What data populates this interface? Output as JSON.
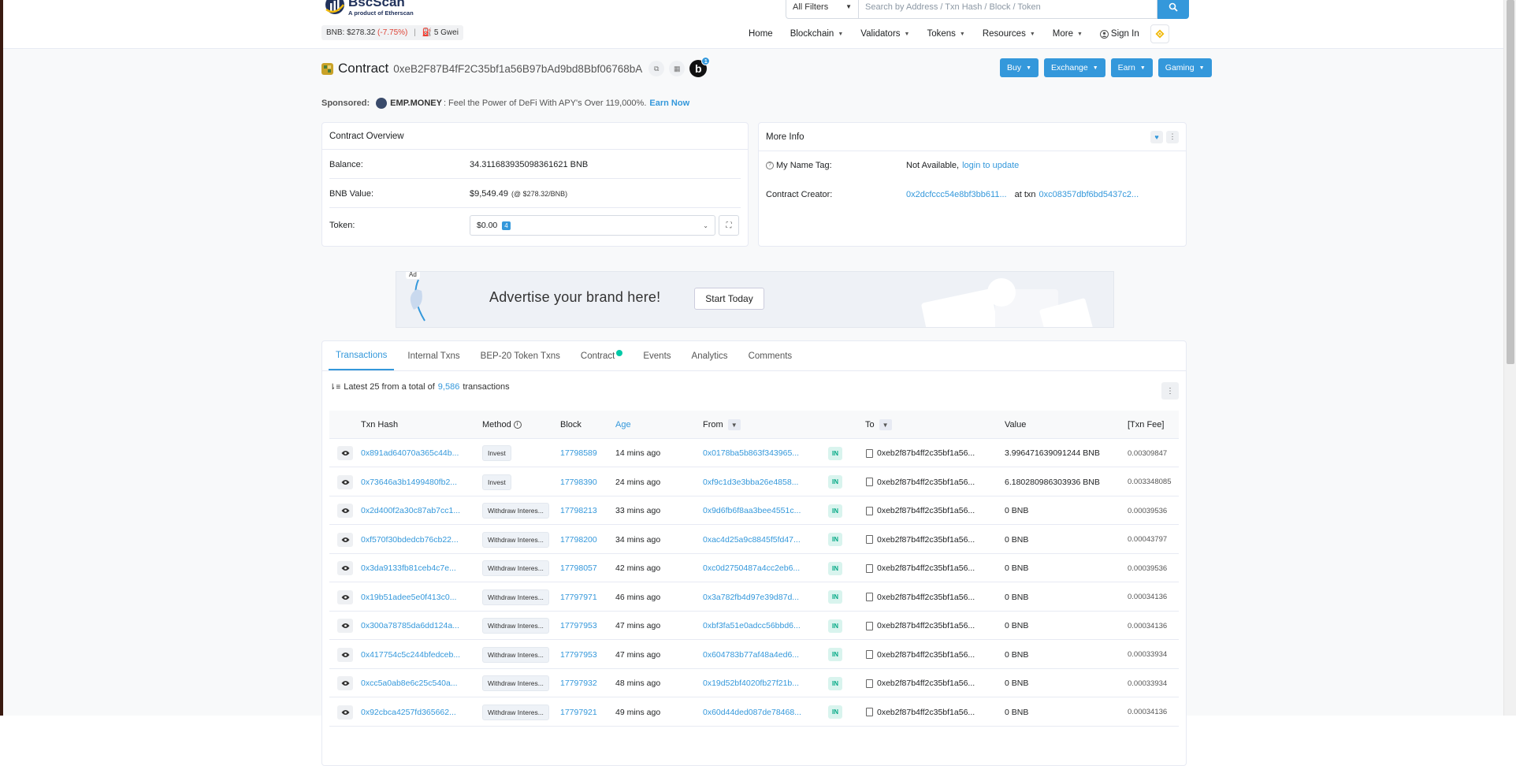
{
  "header": {
    "logo_name": "BscScan",
    "logo_sub": "A product of Etherscan",
    "price_label": "BNB: $278.32",
    "price_change": "(-7.75%)",
    "gas": "5 Gwei",
    "search": {
      "filter": "All Filters",
      "placeholder": "Search by Address / Txn Hash / Block / Token"
    },
    "nav": {
      "home": "Home",
      "blockchain": "Blockchain",
      "validators": "Validators",
      "tokens": "Tokens",
      "resources": "Resources",
      "more": "More",
      "sign_in": "Sign In"
    }
  },
  "contract": {
    "title": "Contract",
    "address": "0xeB2F87B4fF2C35bf1a56B97bAd9bd8Bbf06768bA",
    "b_badge": "b",
    "b_count": "1"
  },
  "actions": {
    "buy": "Buy",
    "exchange": "Exchange",
    "earn": "Earn",
    "gaming": "Gaming"
  },
  "sponsored": {
    "label": "Sponsored:",
    "name": "EMP.MONEY",
    "text": ": Feel the Power of DeFi With APY's Over 119,000%.",
    "cta": "Earn Now"
  },
  "overview": {
    "title": "Contract Overview",
    "balance_label": "Balance:",
    "balance": "34.311683935098361621 BNB",
    "value_label": "BNB Value:",
    "value": "$9,549.49",
    "value_note": "(@ $278.32/BNB)",
    "token_label": "Token:",
    "token_value": "$0.00",
    "token_count": "4"
  },
  "more_info": {
    "title": "More Info",
    "name_tag_label": "My Name Tag:",
    "name_tag_value": "Not Available,",
    "name_tag_link": "login to update",
    "creator_label": "Contract Creator:",
    "creator": "0x2dcfccc54e8bf3bb611...",
    "at_txn": "at txn",
    "creator_txn": "0xc08357dbf6bd5437c2..."
  },
  "ad": {
    "tag": "Ad",
    "text": "Advertise your brand here!",
    "button": "Start Today"
  },
  "tabs": {
    "transactions": "Transactions",
    "internal": "Internal Txns",
    "bep20": "BEP-20 Token Txns",
    "contract": "Contract",
    "events": "Events",
    "analytics": "Analytics",
    "comments": "Comments"
  },
  "summary": {
    "prefix": "Latest 25 from a total of",
    "count": "9,586",
    "suffix": "transactions"
  },
  "columns": {
    "hash": "Txn Hash",
    "method": "Method",
    "block": "Block",
    "age": "Age",
    "from": "From",
    "to": "To",
    "value": "Value",
    "fee": "[Txn Fee]"
  },
  "transactions": [
    {
      "hash": "0x891ad64070a365c44b...",
      "method": "Invest",
      "block": "17798589",
      "age": "14 mins ago",
      "from": "0x0178ba5b863f343965...",
      "dir": "IN",
      "to": "0xeb2f87b4ff2c35bf1a56...",
      "value": "3.996471639091244 BNB",
      "fee": "0.00309847"
    },
    {
      "hash": "0x73646a3b1499480fb2...",
      "method": "Invest",
      "block": "17798390",
      "age": "24 mins ago",
      "from": "0xf9c1d3e3bba26e4858...",
      "dir": "IN",
      "to": "0xeb2f87b4ff2c35bf1a56...",
      "value": "6.180280986303936 BNB",
      "fee": "0.003348085"
    },
    {
      "hash": "0x2d400f2a30c87ab7cc1...",
      "method": "Withdraw Interes...",
      "block": "17798213",
      "age": "33 mins ago",
      "from": "0x9d6fb6f8aa3bee4551c...",
      "dir": "IN",
      "to": "0xeb2f87b4ff2c35bf1a56...",
      "value": "0 BNB",
      "fee": "0.00039536"
    },
    {
      "hash": "0xf570f30bdedcb76cb22...",
      "method": "Withdraw Interes...",
      "block": "17798200",
      "age": "34 mins ago",
      "from": "0xac4d25a9c8845f5fd47...",
      "dir": "IN",
      "to": "0xeb2f87b4ff2c35bf1a56...",
      "value": "0 BNB",
      "fee": "0.00043797"
    },
    {
      "hash": "0x3da9133fb81ceb4c7e...",
      "method": "Withdraw Interes...",
      "block": "17798057",
      "age": "42 mins ago",
      "from": "0xc0d2750487a4cc2eb6...",
      "dir": "IN",
      "to": "0xeb2f87b4ff2c35bf1a56...",
      "value": "0 BNB",
      "fee": "0.00039536"
    },
    {
      "hash": "0x19b51adee5e0f413c0...",
      "method": "Withdraw Interes...",
      "block": "17797971",
      "age": "46 mins ago",
      "from": "0x3a782fb4d97e39d87d...",
      "dir": "IN",
      "to": "0xeb2f87b4ff2c35bf1a56...",
      "value": "0 BNB",
      "fee": "0.00034136"
    },
    {
      "hash": "0x300a78785da6dd124a...",
      "method": "Withdraw Interes...",
      "block": "17797953",
      "age": "47 mins ago",
      "from": "0xbf3fa51e0adcc56bbd6...",
      "dir": "IN",
      "to": "0xeb2f87b4ff2c35bf1a56...",
      "value": "0 BNB",
      "fee": "0.00034136"
    },
    {
      "hash": "0x417754c5c244bfedceb...",
      "method": "Withdraw Interes...",
      "block": "17797953",
      "age": "47 mins ago",
      "from": "0x604783b77af48a4ed6...",
      "dir": "IN",
      "to": "0xeb2f87b4ff2c35bf1a56...",
      "value": "0 BNB",
      "fee": "0.00033934"
    },
    {
      "hash": "0xcc5a0ab8e6c25c540a...",
      "method": "Withdraw Interes...",
      "block": "17797932",
      "age": "48 mins ago",
      "from": "0x19d52bf4020fb27f21b...",
      "dir": "IN",
      "to": "0xeb2f87b4ff2c35bf1a56...",
      "value": "0 BNB",
      "fee": "0.00033934"
    },
    {
      "hash": "0x92cbca4257fd365662...",
      "method": "Withdraw Interes...",
      "block": "17797921",
      "age": "49 mins ago",
      "from": "0x60d44ded087de78468...",
      "dir": "IN",
      "to": "0xeb2f87b4ff2c35bf1a56...",
      "value": "0 BNB",
      "fee": "0.00034136"
    }
  ],
  "colors": {
    "accent": "#3498db",
    "negative": "#de4437",
    "in_badge": "#00a884",
    "brand": "#21325b",
    "bnb": "#f0b90b"
  }
}
